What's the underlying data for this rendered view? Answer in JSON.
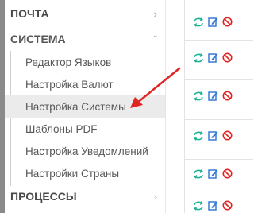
{
  "sidebar": {
    "sections": [
      {
        "label": "ПОЧТА",
        "chevron": "›"
      },
      {
        "label": "СИСТЕМА",
        "chevron": "ˇ"
      },
      {
        "label": "ПРОЦЕССЫ",
        "chevron": "›"
      }
    ],
    "system_items": [
      {
        "label": "Редактор Языков"
      },
      {
        "label": "Настройка Валют"
      },
      {
        "label": "Настройка Системы"
      },
      {
        "label": "Шаблоны PDF"
      },
      {
        "label": "Настройка Уведомлений"
      },
      {
        "label": "Настройки Страны"
      }
    ]
  },
  "actions": {
    "icons": [
      "sync-icon",
      "edit-icon",
      "delete-icon"
    ],
    "colors": {
      "sync": "#1ab394",
      "edit": "#3a7bd5",
      "delete": "#e02424"
    }
  },
  "annotation": {
    "arrow_color": "#e02424"
  }
}
